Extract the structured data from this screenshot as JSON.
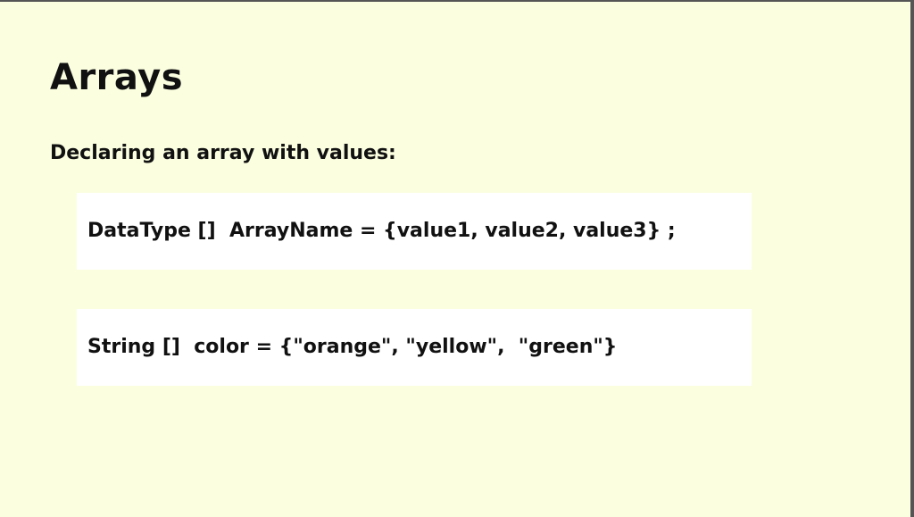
{
  "slide": {
    "title": "Arrays",
    "subtitle": "Declaring an array with values:",
    "code_blocks": [
      "DataType []  ArrayName = {value1, value2, value3} ;",
      "String []  color = {\"orange\", \"yellow\",  \"green\"}"
    ]
  },
  "colors": {
    "background": "#fbfedf",
    "code_box": "#ffffff",
    "text": "#111111"
  }
}
